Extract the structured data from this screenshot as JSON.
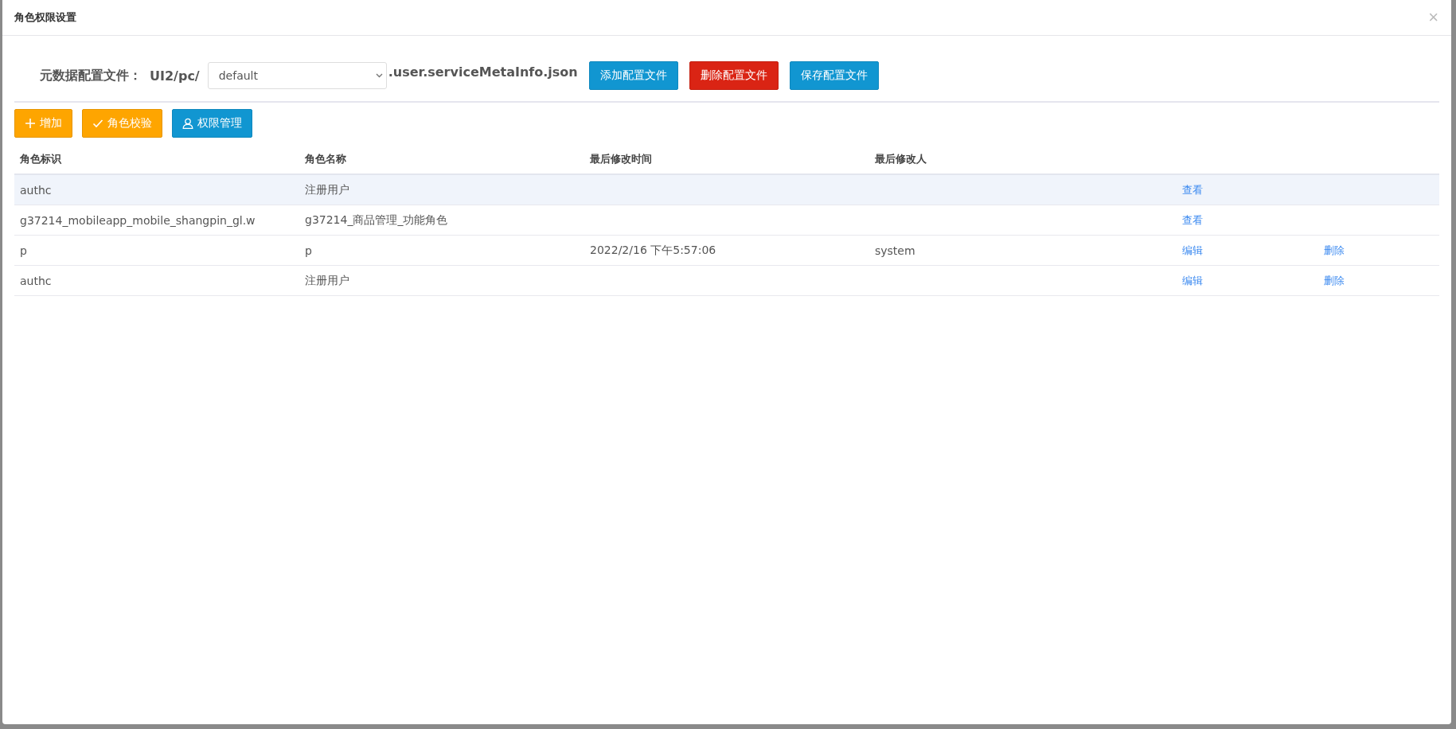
{
  "dialog": {
    "title": "角色权限设置",
    "close": "×"
  },
  "config": {
    "label": "元数据配置文件：",
    "prefix": "UI2/pc/",
    "select_value": "default",
    "suffix": ".user.serviceMetaInfo.json",
    "buttons": [
      {
        "label": "添加配置文件",
        "kind": "primary"
      },
      {
        "label": "删除配置文件",
        "kind": "danger"
      },
      {
        "label": "保存配置文件",
        "kind": "primary"
      }
    ]
  },
  "toolbar": [
    {
      "label": "增加",
      "kind": "add"
    },
    {
      "label": "角色校验",
      "kind": "verify"
    },
    {
      "label": "权限管理",
      "kind": "permissions"
    }
  ],
  "table": {
    "columns": [
      "角色标识",
      "角色名称",
      "最后修改时间",
      "最后修改人"
    ],
    "rows": [
      {
        "cells": [
          "authc",
          "注册用户",
          "",
          ""
        ],
        "selected": true,
        "actions": [
          "查看"
        ]
      },
      {
        "cells": [
          "g37214_mobileapp_mobile_shangpin_gl.w",
          "g37214_商品管理_功能角色",
          "",
          ""
        ],
        "selected": false,
        "actions": [
          "查看"
        ]
      },
      {
        "cells": [
          "p",
          "p",
          "2022/2/16 下午5:57:06",
          "system"
        ],
        "selected": false,
        "actions": [
          "编辑",
          "删除"
        ]
      },
      {
        "cells": [
          "authc",
          "注册用户",
          "",
          ""
        ],
        "selected": false,
        "actions": [
          "编辑",
          "删除"
        ]
      }
    ]
  }
}
